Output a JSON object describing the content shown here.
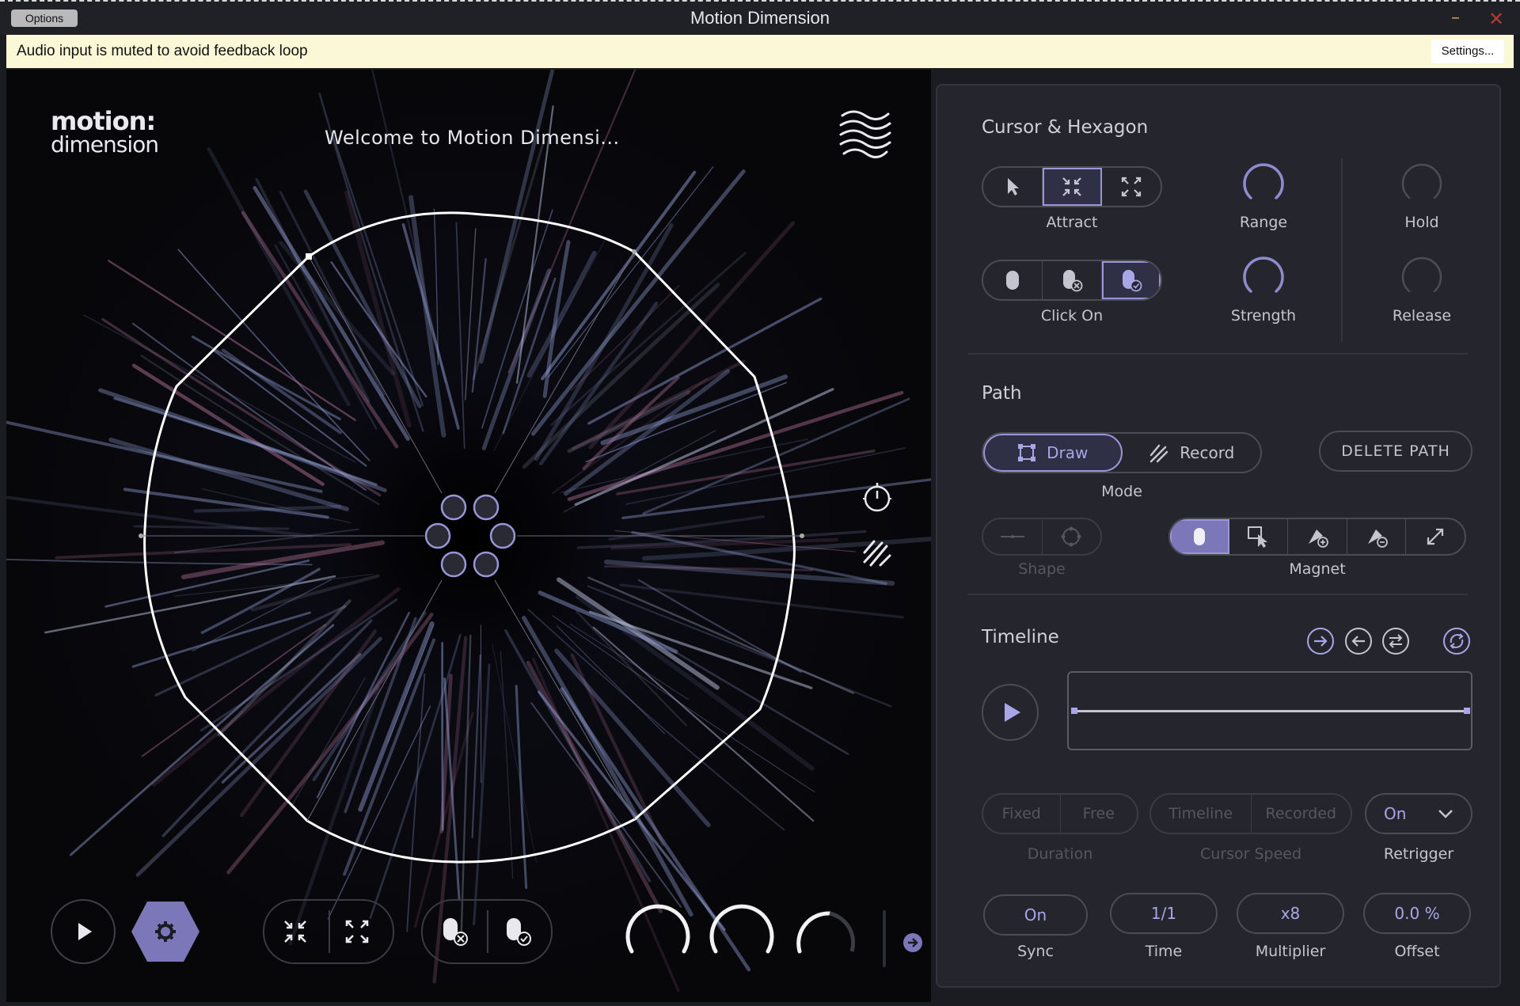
{
  "window": {
    "title": "Motion Dimension",
    "options_label": "Options",
    "minimize_glyph": "–",
    "close_glyph": "✕"
  },
  "notice": {
    "text": "Audio input is muted to avoid feedback loop",
    "settings_label": "Settings..."
  },
  "header": {
    "logo_line1": "motion:",
    "logo_line2": "dimension",
    "welcome": "Welcome to Motion Dimensi..."
  },
  "cursor_hexagon": {
    "title": "Cursor & Hexagon",
    "cursor_mode_label": "Attract",
    "cursor_mode_options": [
      "pointer-icon",
      "attract-icon",
      "repel-icon"
    ],
    "cursor_mode_selected": 1,
    "click_on_label": "Click On",
    "click_on_options": [
      "mouse-icon",
      "mouse-off-icon",
      "mouse-check-icon"
    ],
    "click_on_selected": 2,
    "range_label": "Range",
    "strength_label": "Strength",
    "hold_label": "Hold",
    "release_label": "Release"
  },
  "path": {
    "title": "Path",
    "mode_label": "Mode",
    "draw_label": "Draw",
    "record_label": "Record",
    "mode_selected": "Draw",
    "delete_label": "DELETE PATH",
    "shape_label": "Shape",
    "magnet_label": "Magnet",
    "magnet_selected": 0
  },
  "timeline": {
    "title": "Timeline",
    "duration_fixed": "Fixed",
    "duration_free": "Free",
    "duration_label": "Duration",
    "speed_timeline": "Timeline",
    "speed_recorded": "Recorded",
    "speed_label": "Cursor Speed",
    "retrigger_value": "On",
    "retrigger_label": "Retrigger",
    "sync_value": "On",
    "sync_label": "Sync",
    "time_value": "1/1",
    "time_label": "Time",
    "multiplier_value": "x8",
    "multiplier_label": "Multiplier",
    "offset_value": "0.0 %",
    "offset_label": "Offset"
  },
  "colors": {
    "accent": "#9a95d8",
    "accent_fill": "#7b77b8",
    "panel_bg": "#25262d",
    "visual_bg": "#07070a",
    "notice_bg": "#fbf8d8"
  }
}
